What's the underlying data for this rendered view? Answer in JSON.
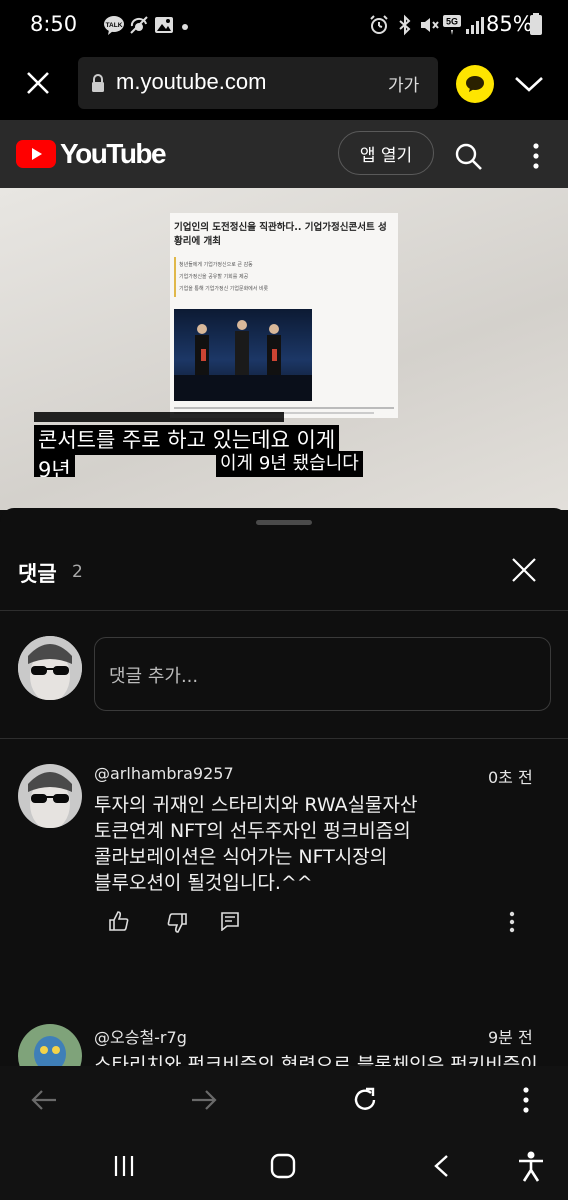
{
  "status_bar": {
    "time": "8:50",
    "talk_badge": "TALK",
    "network": "5G",
    "battery": "85%"
  },
  "browser": {
    "url": "m.youtube.com",
    "reader_label": "가가"
  },
  "youtube": {
    "logo_text": "YouTube",
    "open_app_label": "앱 열기"
  },
  "video": {
    "article_title": "기업인의 도전정신을 직관하다.. 기업가정신콘서트 성황리에 개최",
    "article_bullets": [
      "청년들에게 기업가정신으로 큰 감동",
      "기업가정신을 공유할 기회를 제공",
      "기업을 통해 기업가정신 기업문화에서 비롯"
    ],
    "subtitle_top": "콘서트를 주로 하고 있는데요 이게",
    "subtitle_second": "9년",
    "subtitle_right": "이게 9년 됐습니다"
  },
  "comments": {
    "title": "댓글",
    "count": "2",
    "add_placeholder": "댓글 추가...",
    "items": [
      {
        "author": "@arlhambra9257",
        "time": "0초 전",
        "lines": [
          "투자의 귀재인 스타리치와 RWA실물자산",
          "토큰연계 NFT의 선두주자인 펑크비즘의",
          "콜라보레이션은 식어가는 NFT시장의",
          "블루오션이 될것입니다.^^"
        ]
      },
      {
        "author": "@오승철-r7g",
        "time": "9분 전",
        "lines": [
          "스타리치와 펑크비즘의 협력으로 블록체인은 펑키비즘이"
        ]
      }
    ]
  },
  "colors": {
    "youtube_red": "#ff0000",
    "kakao_yellow": "#fee500",
    "background": "#0f0f0f"
  }
}
